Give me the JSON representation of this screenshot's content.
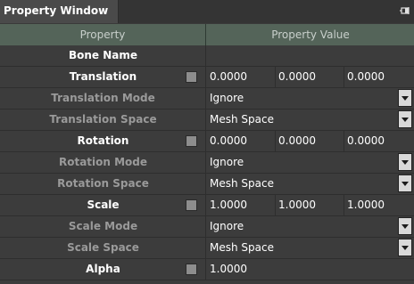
{
  "window": {
    "title": "Property Window",
    "pin_icon": "pin-icon"
  },
  "headers": {
    "property": "Property",
    "value": "Property Value"
  },
  "rows": {
    "bone_name": {
      "label": "Bone Name"
    },
    "translation": {
      "label": "Translation",
      "checked": false,
      "x": "0.0000",
      "y": "0.0000",
      "z": "0.0000"
    },
    "translation_mode": {
      "label": "Translation Mode",
      "value": "Ignore"
    },
    "translation_space": {
      "label": "Translation Space",
      "value": "Mesh Space"
    },
    "rotation": {
      "label": "Rotation",
      "checked": false,
      "x": "0.0000",
      "y": "0.0000",
      "z": "0.0000"
    },
    "rotation_mode": {
      "label": "Rotation Mode",
      "value": "Ignore"
    },
    "rotation_space": {
      "label": "Rotation Space",
      "value": "Mesh Space"
    },
    "scale": {
      "label": "Scale",
      "checked": false,
      "x": "1.0000",
      "y": "1.0000",
      "z": "1.0000"
    },
    "scale_mode": {
      "label": "Scale Mode",
      "value": "Ignore"
    },
    "scale_space": {
      "label": "Scale Space",
      "value": "Mesh Space"
    },
    "alpha": {
      "label": "Alpha",
      "checked": false,
      "value": "1.0000"
    }
  },
  "colors": {
    "header_bg": "#546459",
    "panel_bg": "#3c3c3c",
    "dim_text": "#9a9a9a"
  }
}
